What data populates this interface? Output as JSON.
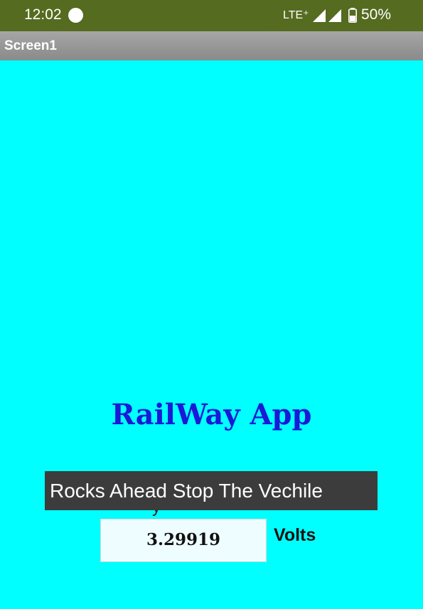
{
  "status_bar": {
    "time": "12:02",
    "network": "LTE⁺",
    "battery": "50%",
    "icons": [
      "notification-dot-icon",
      "signal-icon",
      "signal-icon",
      "battery-icon"
    ]
  },
  "title_bar": {
    "title": "Screen1"
  },
  "main": {
    "heading": "RailWay App",
    "obscured_label": "y",
    "value": "3.29919",
    "unit": "Volts"
  },
  "toast": {
    "message": "Rocks Ahead Stop The Vechile"
  },
  "colors": {
    "background": "#00ffff",
    "status_bar": "#556b1f",
    "heading": "#1a1ad6",
    "toast": "#3c3c3c"
  }
}
